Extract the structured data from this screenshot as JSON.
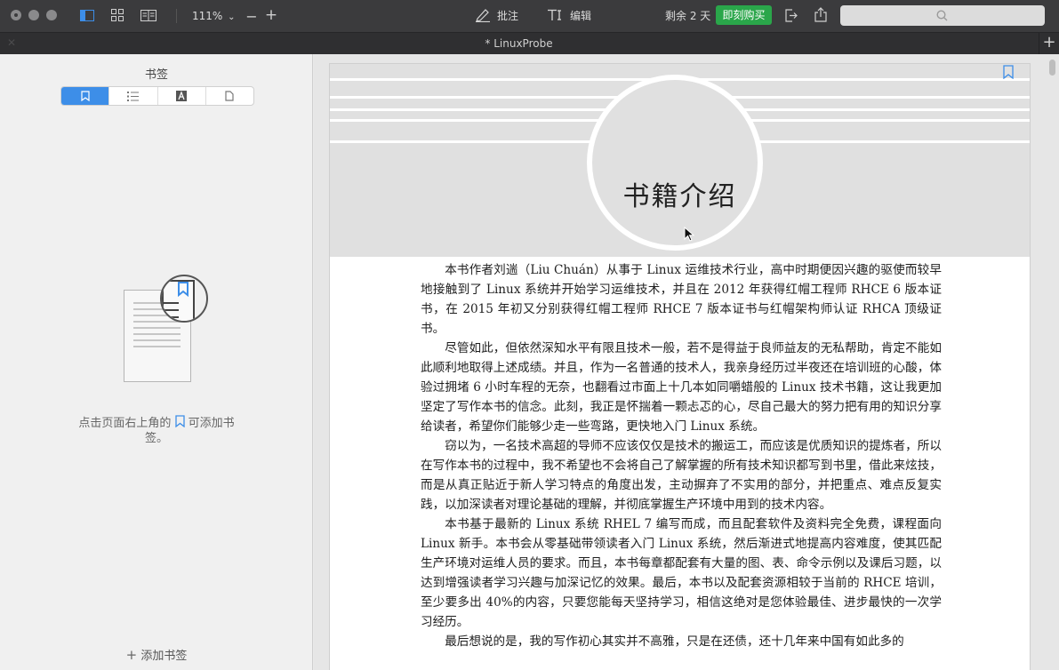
{
  "toolbar": {
    "zoom": "111%",
    "annotate_label": "批注",
    "edit_label": "编辑",
    "trial_text": "剩余 2 天",
    "buy_label": "即刻购买",
    "search_placeholder": ""
  },
  "tab": {
    "title": "* LinuxProbe"
  },
  "sidebar": {
    "title": "书签",
    "segments": [
      "bookmark-icon",
      "list-icon",
      "text-icon",
      "page-icon"
    ],
    "empty_text_before": "点击页面右上角的",
    "empty_text_after": "可添加书签。",
    "add_label": "添加书签"
  },
  "document": {
    "chapter_title": "书籍介绍",
    "paragraphs": [
      "本书作者刘遄（Liu Chuán）从事于 Linux 运维技术行业，高中时期便因兴趣的驱使而较早地接触到了 Linux 系统并开始学习运维技术，并且在 2012 年获得红帽工程师 RHCE 6 版本证书，在 2015 年初又分别获得红帽工程师 RHCE 7 版本证书与红帽架构师认证 RHCA 顶级证书。",
      "尽管如此，但依然深知水平有限且技术一般，若不是得益于良师益友的无私帮助，肯定不能如此顺利地取得上述成绩。并且，作为一名普通的技术人，我亲身经历过半夜还在培训班的心酸，体验过拥堵 6 小时车程的无奈，也翻看过市面上十几本如同嚼蜡般的 Linux 技术书籍，这让我更加坚定了写作本书的信念。此刻，我正是怀揣着一颗忐忑的心，尽自己最大的努力把有用的知识分享给读者，希望你们能够少走一些弯路，更快地入门 Linux 系统。",
      "窃以为，一名技术高超的导师不应该仅仅是技术的搬运工，而应该是优质知识的提炼者，所以在写作本书的过程中，我不希望也不会将自己了解掌握的所有技术知识都写到书里，借此来炫技，而是从真正贴近于新人学习特点的角度出发，主动摒弃了不实用的部分，并把重点、难点反复实践，以加深读者对理论基础的理解，并彻底掌握生产环境中用到的技术内容。",
      "本书基于最新的 Linux 系统 RHEL 7 编写而成，而且配套软件及资料完全免费，课程面向 Linux 新手。本书会从零基础带领读者入门 Linux 系统，然后渐进式地提高内容难度，使其匹配生产环境对运维人员的要求。而且，本书每章都配套有大量的图、表、命令示例以及课后习题，以达到增强读者学习兴趣与加深记忆的效果。最后，本书以及配套资源相较于当前的 RHCE 培训，至少要多出 40%的内容，只要您能每天坚持学习，相信这绝对是您体验最佳、进步最快的一次学习经历。",
      "最后想说的是，我的写作初心其实并不高雅，只是在还债，还十几年来中国有如此多的"
    ]
  }
}
